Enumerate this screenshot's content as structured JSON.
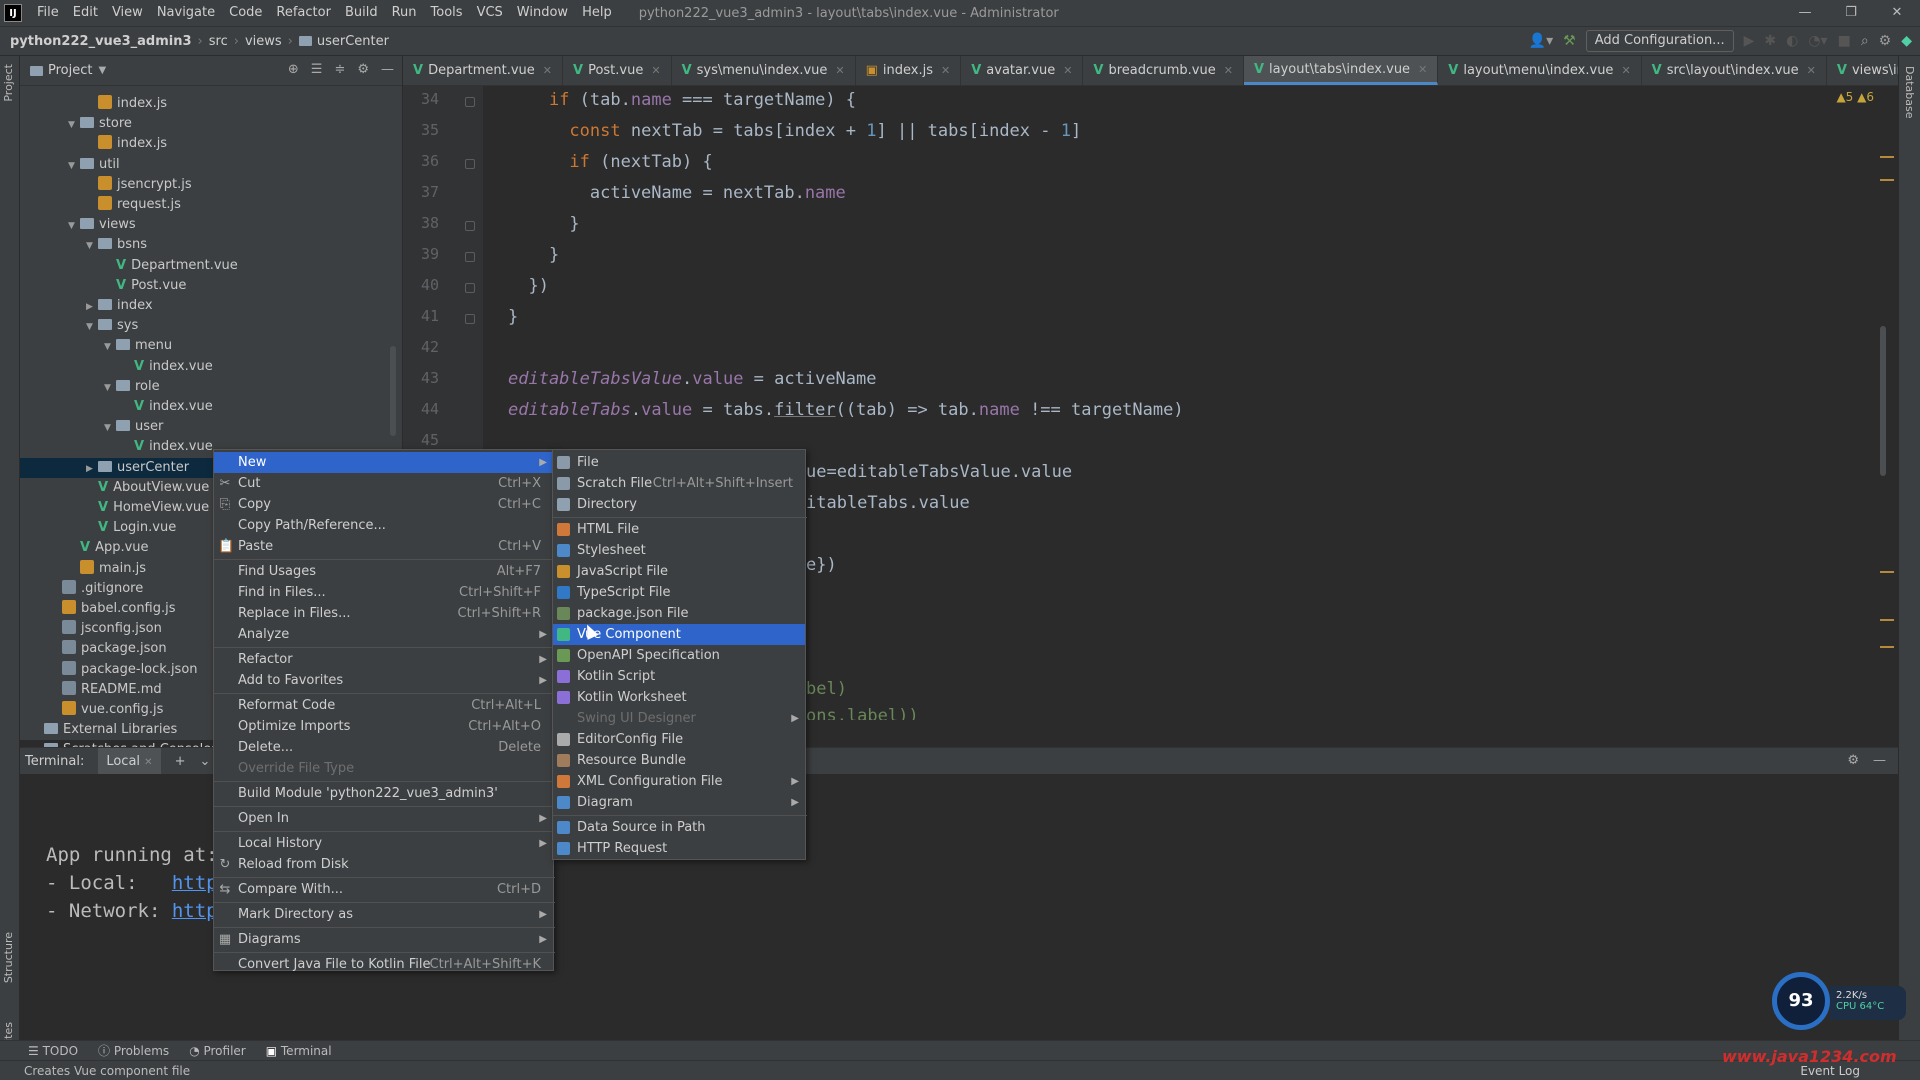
{
  "titlebar": {
    "menu": [
      "File",
      "Edit",
      "View",
      "Navigate",
      "Code",
      "Refactor",
      "Build",
      "Run",
      "Tools",
      "VCS",
      "Window",
      "Help"
    ],
    "window_title": "python222_vue3_admin3 - layout\\tabs\\index.vue - Administrator"
  },
  "navbar": {
    "project": "python222_vue3_admin3",
    "crumbs": [
      "src",
      "views",
      "userCenter"
    ],
    "add_configuration": "Add Configuration..."
  },
  "project_panel": {
    "title": "Project",
    "tree": [
      {
        "label": "index.js",
        "type": "js",
        "depth": 4
      },
      {
        "label": "store",
        "type": "folder",
        "depth": 3,
        "open": true
      },
      {
        "label": "index.js",
        "type": "js",
        "depth": 4
      },
      {
        "label": "util",
        "type": "folder",
        "depth": 3,
        "open": true
      },
      {
        "label": "jsencrypt.js",
        "type": "js",
        "depth": 4
      },
      {
        "label": "request.js",
        "type": "js",
        "depth": 4
      },
      {
        "label": "views",
        "type": "folder",
        "depth": 3,
        "open": true
      },
      {
        "label": "bsns",
        "type": "folder",
        "depth": 4,
        "open": true
      },
      {
        "label": "Department.vue",
        "type": "vue",
        "depth": 5
      },
      {
        "label": "Post.vue",
        "type": "vue",
        "depth": 5
      },
      {
        "label": "index",
        "type": "folder",
        "depth": 4,
        "open": false
      },
      {
        "label": "sys",
        "type": "folder",
        "depth": 4,
        "open": true
      },
      {
        "label": "menu",
        "type": "folder",
        "depth": 5,
        "open": true
      },
      {
        "label": "index.vue",
        "type": "vue",
        "depth": 6
      },
      {
        "label": "role",
        "type": "folder",
        "depth": 5,
        "open": true
      },
      {
        "label": "index.vue",
        "type": "vue",
        "depth": 6
      },
      {
        "label": "user",
        "type": "folder",
        "depth": 5,
        "open": true
      },
      {
        "label": "index.vue",
        "type": "vue",
        "depth": 6
      },
      {
        "label": "userCenter",
        "type": "folder",
        "depth": 4,
        "selected": true
      },
      {
        "label": "AboutView.vue",
        "type": "vue",
        "depth": 4
      },
      {
        "label": "HomeView.vue",
        "type": "vue",
        "depth": 4
      },
      {
        "label": "Login.vue",
        "type": "vue",
        "depth": 4
      },
      {
        "label": "App.vue",
        "type": "vue",
        "depth": 3
      },
      {
        "label": "main.js",
        "type": "js",
        "depth": 3
      },
      {
        "label": ".gitignore",
        "type": "json",
        "depth": 2
      },
      {
        "label": "babel.config.js",
        "type": "js",
        "depth": 2
      },
      {
        "label": "jsconfig.json",
        "type": "json",
        "depth": 2
      },
      {
        "label": "package.json",
        "type": "json",
        "depth": 2
      },
      {
        "label": "package-lock.json",
        "type": "json",
        "depth": 2
      },
      {
        "label": "README.md",
        "type": "json",
        "depth": 2
      },
      {
        "label": "vue.config.js",
        "type": "js",
        "depth": 2
      },
      {
        "label": "External Libraries",
        "type": "lib",
        "depth": 1
      },
      {
        "label": "Scratches and Consoles",
        "type": "lib",
        "depth": 1
      }
    ]
  },
  "editor_tabs": [
    {
      "label": "Department.vue",
      "active": false
    },
    {
      "label": "Post.vue",
      "active": false
    },
    {
      "label": "sys\\menu\\index.vue",
      "active": false
    },
    {
      "label": "index.js",
      "active": false
    },
    {
      "label": "avatar.vue",
      "active": false
    },
    {
      "label": "breadcrumb.vue",
      "active": false
    },
    {
      "label": "layout\\tabs\\index.vue",
      "active": true
    },
    {
      "label": "layout\\menu\\index.vue",
      "active": false
    },
    {
      "label": "src\\layout\\index.vue",
      "active": false
    },
    {
      "label": "views\\index\\index.vue",
      "active": false
    }
  ],
  "editor": {
    "warnings": "▲5 ▲6",
    "line_numbers": [
      "34",
      "35",
      "36",
      "37",
      "38",
      "39",
      "40",
      "41",
      "42",
      "43",
      "44",
      "45"
    ],
    "code_tail_lines": [
      "ue=editableTabsValue.value",
      "itableTabs.value",
      "e})",
      "bel)",
      "ons.label))"
    ]
  },
  "terminal": {
    "label": "Terminal:",
    "tab": "Local",
    "lines": [
      {
        "prefix": "App running at:",
        "link": ""
      },
      {
        "prefix": "- Local:   ",
        "link": "http"
      },
      {
        "prefix": "- Network: ",
        "link": "http"
      }
    ]
  },
  "bottom_tools": [
    "TODO",
    "Problems",
    "Profiler",
    "Terminal"
  ],
  "status_text": "Creates Vue component file",
  "context_menu": [
    {
      "label": "New",
      "icon": "",
      "shortcut": "",
      "submenu": true,
      "highlighted": true
    },
    {
      "label": "Cut",
      "icon": "✂",
      "shortcut": "Ctrl+X"
    },
    {
      "label": "Copy",
      "icon": "⎘",
      "shortcut": "Ctrl+C"
    },
    {
      "label": "Copy Path/Reference...",
      "icon": "",
      "shortcut": ""
    },
    {
      "label": "Paste",
      "icon": "📋",
      "shortcut": "Ctrl+V"
    },
    {
      "sep": true
    },
    {
      "label": "Find Usages",
      "icon": "",
      "shortcut": "Alt+F7"
    },
    {
      "label": "Find in Files...",
      "icon": "",
      "shortcut": "Ctrl+Shift+F"
    },
    {
      "label": "Replace in Files...",
      "icon": "",
      "shortcut": "Ctrl+Shift+R"
    },
    {
      "label": "Analyze",
      "icon": "",
      "shortcut": "",
      "submenu": true
    },
    {
      "sep": true
    },
    {
      "label": "Refactor",
      "icon": "",
      "shortcut": "",
      "submenu": true
    },
    {
      "label": "Add to Favorites",
      "icon": "",
      "shortcut": "",
      "submenu": true
    },
    {
      "sep": true
    },
    {
      "label": "Reformat Code",
      "icon": "",
      "shortcut": "Ctrl+Alt+L"
    },
    {
      "label": "Optimize Imports",
      "icon": "",
      "shortcut": "Ctrl+Alt+O"
    },
    {
      "label": "Delete...",
      "icon": "",
      "shortcut": "Delete"
    },
    {
      "label": "Override File Type",
      "icon": "",
      "shortcut": "",
      "disabled": true
    },
    {
      "sep": true
    },
    {
      "label": "Build Module 'python222_vue3_admin3'",
      "icon": "",
      "shortcut": ""
    },
    {
      "sep": true
    },
    {
      "label": "Open In",
      "icon": "",
      "shortcut": "",
      "submenu": true
    },
    {
      "sep": true
    },
    {
      "label": "Local History",
      "icon": "",
      "shortcut": "",
      "submenu": true
    },
    {
      "label": "Reload from Disk",
      "icon": "↻",
      "shortcut": ""
    },
    {
      "sep": true
    },
    {
      "label": "Compare With...",
      "icon": "⇆",
      "shortcut": "Ctrl+D"
    },
    {
      "sep": true
    },
    {
      "label": "Mark Directory as",
      "icon": "",
      "shortcut": "",
      "submenu": true
    },
    {
      "sep": true
    },
    {
      "label": "Diagrams",
      "icon": "▦",
      "shortcut": "",
      "submenu": true
    },
    {
      "sep": true
    },
    {
      "label": "Convert Java File to Kotlin File",
      "icon": "",
      "shortcut": "Ctrl+Alt+Shift+K"
    }
  ],
  "submenu": [
    {
      "label": "File",
      "shortcut": "",
      "color": "#8a9aa8"
    },
    {
      "label": "Scratch File",
      "shortcut": "Ctrl+Alt+Shift+Insert",
      "color": "#8a9aa8"
    },
    {
      "label": "Directory",
      "shortcut": "",
      "color": "#8fa0b0"
    },
    {
      "sep": true
    },
    {
      "label": "HTML File",
      "shortcut": "",
      "color": "#d0783a"
    },
    {
      "label": "Stylesheet",
      "shortcut": "",
      "color": "#4d89c9"
    },
    {
      "label": "JavaScript File",
      "shortcut": "",
      "color": "#c98f2c"
    },
    {
      "label": "TypeScript File",
      "shortcut": "",
      "color": "#3178c6"
    },
    {
      "label": "package.json File",
      "shortcut": "",
      "color": "#6a8759"
    },
    {
      "label": "Vue Component",
      "shortcut": "",
      "color": "#41b883",
      "highlighted": true
    },
    {
      "label": "OpenAPI Specification",
      "shortcut": "",
      "color": "#6a9955"
    },
    {
      "label": "Kotlin Script",
      "shortcut": "",
      "color": "#8c6fd6"
    },
    {
      "label": "Kotlin Worksheet",
      "shortcut": "",
      "color": "#8c6fd6"
    },
    {
      "label": "Swing UI Designer",
      "shortcut": "",
      "disabled": true,
      "submenu": true
    },
    {
      "label": "EditorConfig File",
      "shortcut": "",
      "color": "#aaaaaa"
    },
    {
      "label": "Resource Bundle",
      "shortcut": "",
      "color": "#a07b5c"
    },
    {
      "label": "XML Configuration File",
      "shortcut": "",
      "color": "#d0783a",
      "submenu": true
    },
    {
      "label": "Diagram",
      "shortcut": "",
      "color": "#4d89c9",
      "submenu": true
    },
    {
      "sep": true
    },
    {
      "label": "Data Source in Path",
      "shortcut": "",
      "color": "#4d89c9"
    },
    {
      "label": "HTTP Request",
      "shortcut": "",
      "color": "#4d89c9"
    }
  ],
  "perf": {
    "value": "93",
    "rate": "2.2K/s",
    "cpu": "CPU 64°C"
  },
  "watermark": "www.java1234.com",
  "event_log": "Event Log"
}
